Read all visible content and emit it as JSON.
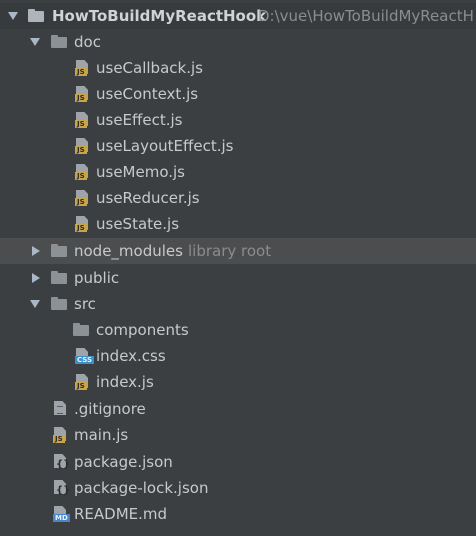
{
  "project": {
    "name": "HowToBuildMyReactHook",
    "path": "D:\\vue\\HowToBuildMyReactH"
  },
  "tree": {
    "doc": {
      "label": "doc",
      "files": [
        {
          "label": "useCallback.js",
          "badge": "JS"
        },
        {
          "label": "useContext.js",
          "badge": "JS"
        },
        {
          "label": "useEffect.js",
          "badge": "JS"
        },
        {
          "label": "useLayoutEffect.js",
          "badge": "JS"
        },
        {
          "label": "useMemo.js",
          "badge": "JS"
        },
        {
          "label": "useReducer.js",
          "badge": "JS"
        },
        {
          "label": "useState.js",
          "badge": "JS"
        }
      ]
    },
    "node_modules": {
      "label": "node_modules",
      "hint": "library root"
    },
    "public": {
      "label": "public"
    },
    "src": {
      "label": "src",
      "components": "components",
      "index_css": {
        "label": "index.css",
        "badge": "CSS"
      },
      "index_js": {
        "label": "index.js",
        "badge": "JS"
      }
    },
    "gitignore": {
      "label": ".gitignore"
    },
    "main_js": {
      "label": "main.js",
      "badge": "JS"
    },
    "package_json": {
      "label": "package.json",
      "badge": "{}"
    },
    "package_lock": {
      "label": "package-lock.json",
      "badge": "{}"
    },
    "readme": {
      "label": "README.md",
      "badge": "MD"
    }
  },
  "colors": {
    "background": "#3c3f41",
    "selected_row": "#4b4d4f",
    "text": "#c7c9cc",
    "hint_text": "#8a8d90",
    "js_badge": "#c9a54a",
    "css_badge": "#3d8fc9",
    "md_badge": "#4a86c7"
  }
}
